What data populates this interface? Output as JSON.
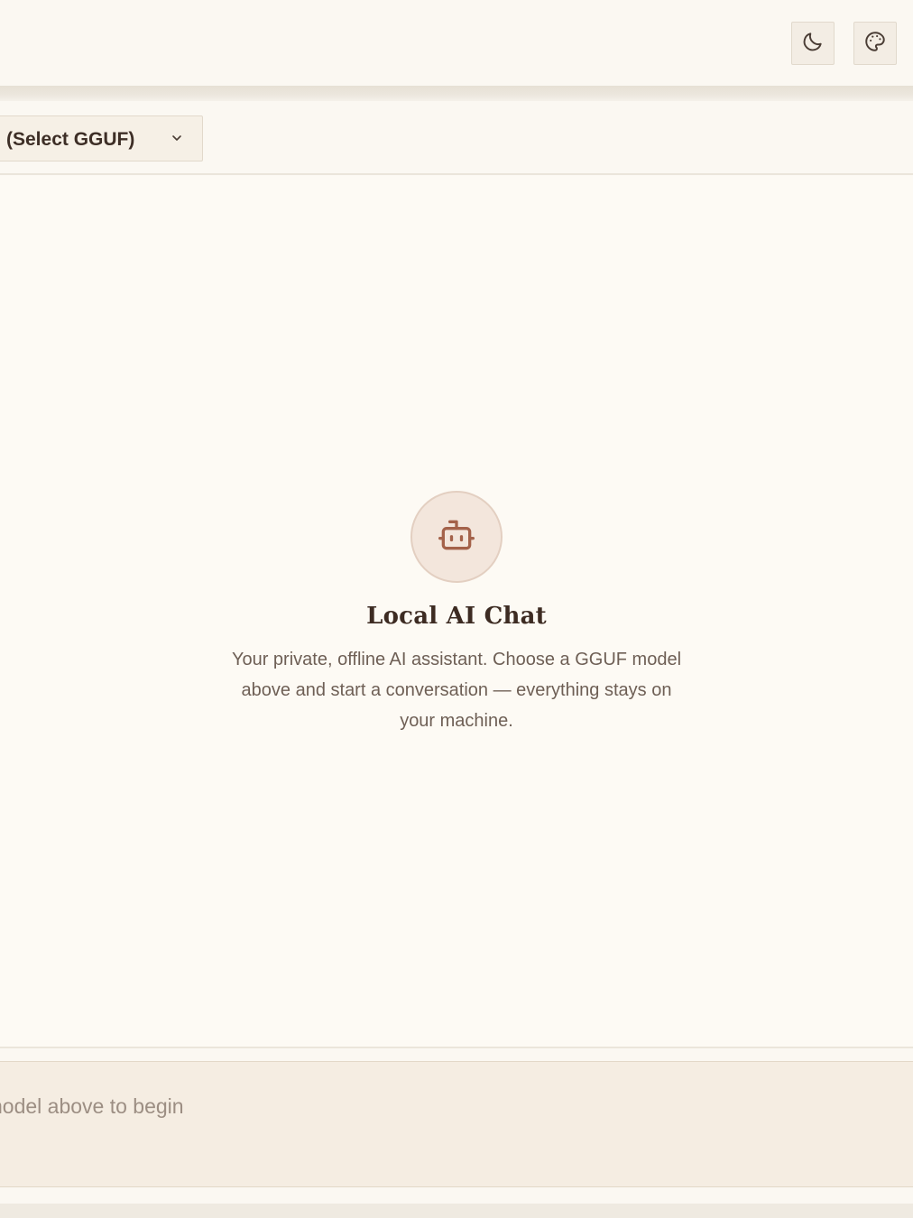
{
  "header": {
    "theme_toggle_icon": "moon-icon",
    "palette_icon": "palette-icon"
  },
  "model_bar": {
    "select_label": "(Select GGUF)",
    "chevron_icon": "chevron-down-icon"
  },
  "empty_state": {
    "icon": "bot-icon",
    "title": "Local AI Chat",
    "description": "Your private, offline AI assistant. Choose a GGUF model above and start a conversation — everything stays on your machine."
  },
  "composer": {
    "placeholder": "nodel above to begin"
  },
  "colors": {
    "background": "#fcf9f3",
    "accent": "#a4624a",
    "text": "#3d2b22",
    "muted_text": "#6e5f55"
  }
}
